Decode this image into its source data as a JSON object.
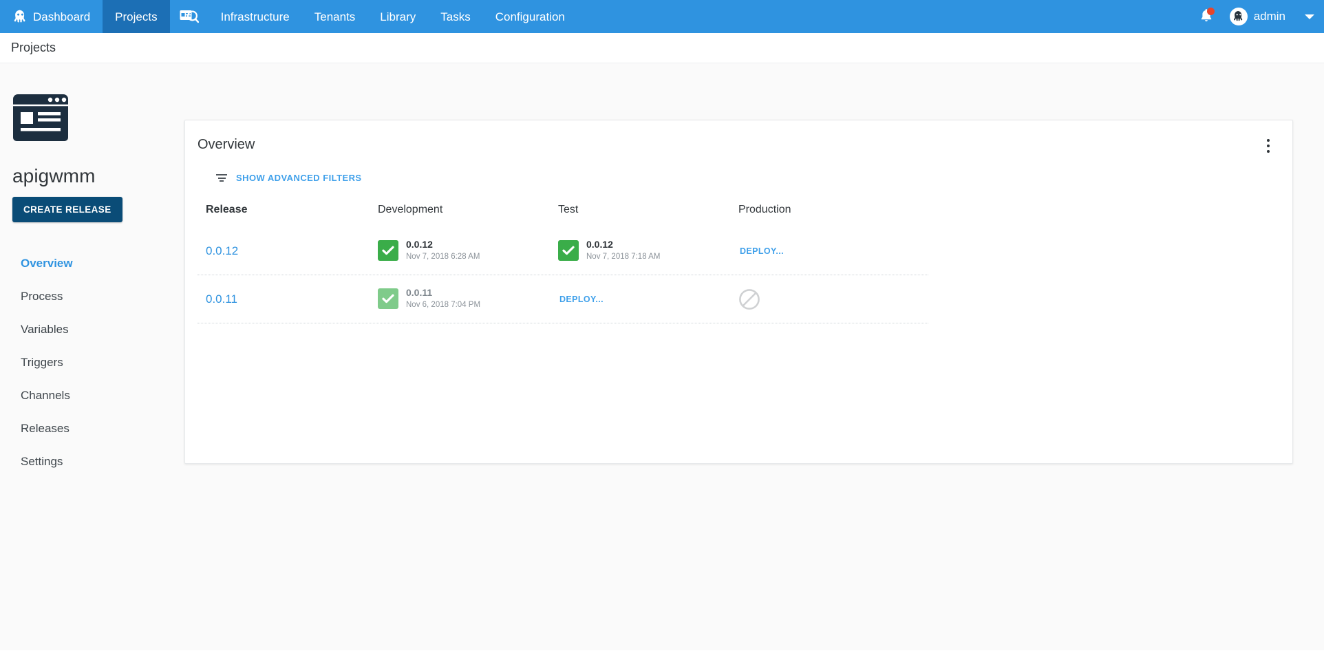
{
  "topnav": {
    "items": [
      {
        "label": "Dashboard",
        "icon": "octopus-icon",
        "active": false
      },
      {
        "label": "Projects",
        "icon": "",
        "active": true
      },
      {
        "label": "",
        "icon": "project-search-icon",
        "active": false
      },
      {
        "label": "Infrastructure",
        "icon": "",
        "active": false
      },
      {
        "label": "Tenants",
        "icon": "",
        "active": false
      },
      {
        "label": "Library",
        "icon": "",
        "active": false
      },
      {
        "label": "Tasks",
        "icon": "",
        "active": false
      },
      {
        "label": "Configuration",
        "icon": "",
        "active": false
      }
    ],
    "notifications_icon": "bell-icon",
    "notification_badge": "",
    "user": "admin",
    "avatar_icon": "octopus-avatar-icon",
    "caret_icon": "chevron-down-icon",
    "bar_color": "#2f93e0",
    "active_color": "#1c6fb5",
    "badge_color": "#e8452c"
  },
  "breadcrumb": {
    "text": "Projects"
  },
  "sidebar": {
    "project_icon": "project-window-icon",
    "project_name": "apigwmm",
    "create_release_label": "CREATE RELEASE",
    "create_release_color": "#0a4c77",
    "items": [
      {
        "label": "Overview",
        "active": true
      },
      {
        "label": "Process",
        "active": false
      },
      {
        "label": "Variables",
        "active": false
      },
      {
        "label": "Triggers",
        "active": false
      },
      {
        "label": "Channels",
        "active": false
      },
      {
        "label": "Releases",
        "active": false
      },
      {
        "label": "Settings",
        "active": false
      }
    ]
  },
  "card": {
    "title": "Overview",
    "overflow_icon": "kebab-menu-icon",
    "filters": {
      "icon": "filter-icon",
      "label": "SHOW ADVANCED FILTERS"
    },
    "columns": [
      "Release",
      "Development",
      "Test",
      "Production"
    ],
    "rows": [
      {
        "release": "0.0.12",
        "development": {
          "state": "success",
          "version": "0.0.12",
          "date": "Nov 7, 2018 6:28 AM"
        },
        "test": {
          "state": "success",
          "version": "0.0.12",
          "date": "Nov 7, 2018 7:18 AM"
        },
        "production": {
          "state": "deploy",
          "label": "DEPLOY..."
        }
      },
      {
        "release": "0.0.11",
        "development": {
          "state": "success-faded",
          "version": "0.0.11",
          "date": "Nov 6, 2018 7:04 PM"
        },
        "test": {
          "state": "deploy",
          "label": "DEPLOY..."
        },
        "production": {
          "state": "blocked",
          "icon": "blocked-icon"
        }
      }
    ]
  },
  "colors": {
    "accent_blue": "#2f93e0",
    "link_blue": "#3fa0ea",
    "success_green": "#3aad49",
    "success_green_faded": "#7fcb8a",
    "dark_navy": "#0a4c77",
    "page_bg": "#fafafa"
  }
}
